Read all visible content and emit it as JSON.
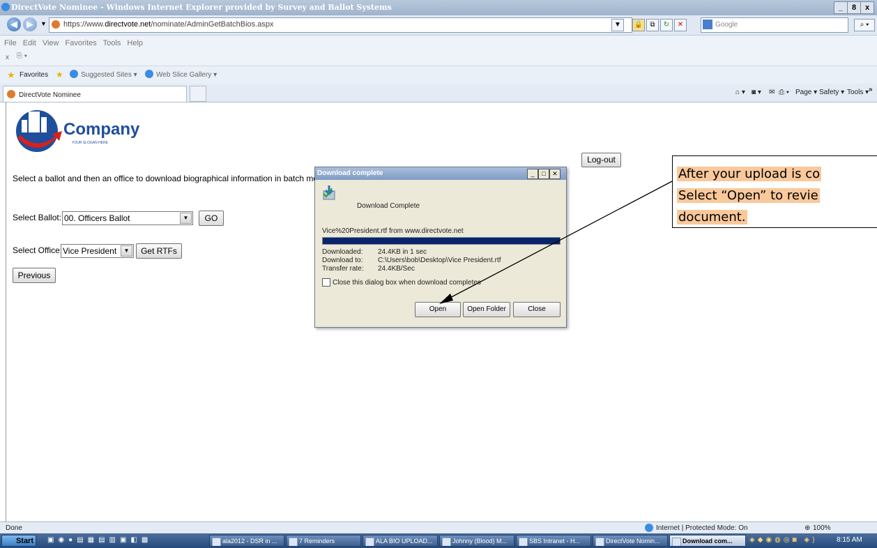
{
  "window": {
    "title": "DirectVote Nominee - Windows Internet Explorer provided by Survey and Ballot Systems",
    "controls": [
      "_",
      "8",
      "x"
    ]
  },
  "address": {
    "url_prefix": "https://www.",
    "url_domain": "directvote.net",
    "url_path": "/nominate/AdminGetBatchBios.aspx",
    "search_placeholder": "Google"
  },
  "menu": {
    "items": [
      "File",
      "Edit",
      "View",
      "Favorites",
      "Tools",
      "Help"
    ],
    "close_glyph": "x"
  },
  "favorites": {
    "label": "Favorites",
    "items": [
      "Suggested Sites ▾",
      "Web Slice Gallery ▾"
    ]
  },
  "tab": {
    "title": "DirectVote Nominee"
  },
  "commandbar": {
    "page": "Page ▾",
    "safety": "Safety ▾",
    "tools": "Tools ▾",
    "overflow": "»"
  },
  "page": {
    "logo_text": "Company",
    "logo_slogan": "YOUR SLOGAN HERE",
    "logout": "Log-out",
    "instruction": "Select a ballot and then an office to download biographical information in batch mode (a",
    "ballot_label": "Select Ballot:",
    "ballot_value": "00. Officers Ballot",
    "go": "GO",
    "office_label": "Select Office:",
    "office_value": "Vice President",
    "get_rtfs": "Get RTFs",
    "previous": "Previous"
  },
  "dialog": {
    "title": "Download complete",
    "heading": "Download Complete",
    "file": "Vice%20President.rtf from www.directvote.net",
    "progress": 1.0,
    "rows": [
      {
        "k": "Downloaded:",
        "v": "24.4KB in 1 sec"
      },
      {
        "k": "Download to:",
        "v": "C:\\Users\\bob\\Desktop\\Vice President.rtf"
      },
      {
        "k": "Transfer rate:",
        "v": "24.4KB/Sec"
      }
    ],
    "checkbox": "Close this dialog box when download completes",
    "open": "Open",
    "open_folder": "Open Folder",
    "close": "Close"
  },
  "callout": {
    "line1": "After your upload is co",
    "line2": "Select “Open” to revie",
    "line3": "document."
  },
  "status": {
    "text": "Done",
    "zone": "Internet | Protected Mode: On",
    "zoom": "100%"
  },
  "taskbar": {
    "start": "Start",
    "tasks": [
      "ala2012 - DSR in ...",
      "7 Reminders",
      "ALA BIO UPLOAD...",
      "Johnny (Blood) M...",
      "SBS Intranet - H...",
      "DirectVote Nomin...",
      "Download com..."
    ],
    "clock": "8:15 AM"
  },
  "colors": {
    "callout_bg": "#f9c89b",
    "progress": "#0a246a",
    "logo_blue": "#1f4e9c",
    "logo_red": "#d8201d"
  }
}
